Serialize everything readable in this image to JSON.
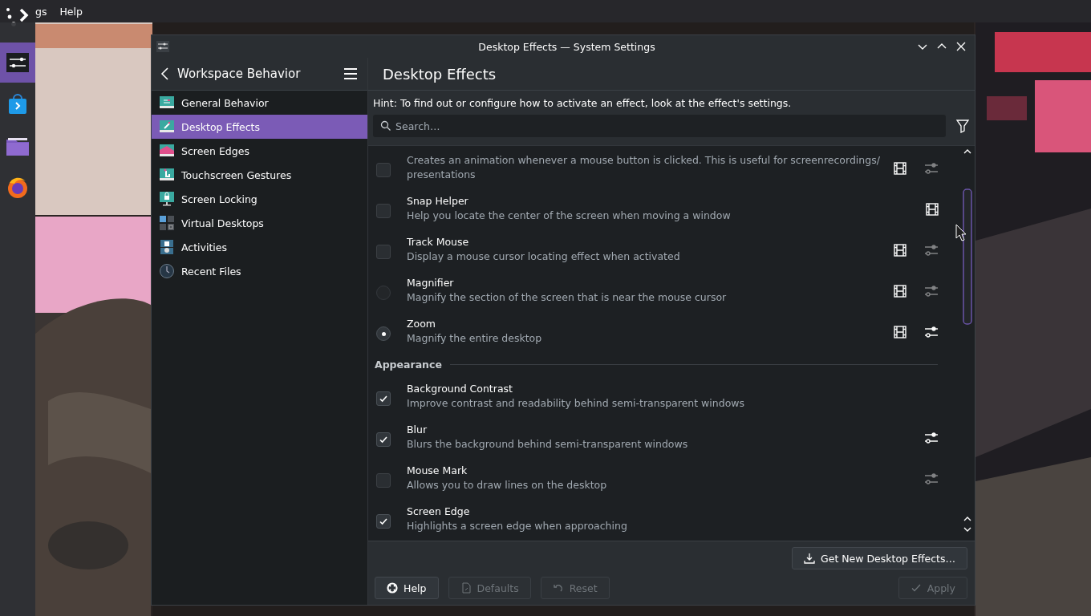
{
  "menu_bar": {
    "items": [
      "gs",
      "Help"
    ]
  },
  "dock": {
    "items": [
      {
        "selected": true
      },
      {
        "selected": false
      },
      {
        "selected": false
      },
      {
        "selected": false
      }
    ]
  },
  "window": {
    "title": "Desktop Effects — System Settings"
  },
  "sidebar": {
    "title": "Workspace Behavior",
    "items": [
      {
        "label": "General Behavior",
        "selected": false
      },
      {
        "label": "Desktop Effects",
        "selected": true
      },
      {
        "label": "Screen Edges",
        "selected": false
      },
      {
        "label": "Touchscreen Gestures",
        "selected": false
      },
      {
        "label": "Screen Locking",
        "selected": false
      },
      {
        "label": "Virtual Desktops",
        "selected": false
      },
      {
        "label": "Activities",
        "selected": false
      },
      {
        "label": "Recent Files",
        "selected": false
      }
    ]
  },
  "page": {
    "title": "Desktop Effects",
    "hint": "Hint: To find out or configure how to activate an effect, look at the effect's settings.",
    "search": {
      "placeholder": "Search…"
    }
  },
  "effects": [
    {
      "kind": "checkbox",
      "checked": false,
      "description": "Creates an animation whenever a mouse button is clicked. This is useful for screenrecordings/ presentations",
      "video": true,
      "configure": true
    },
    {
      "kind": "checkbox",
      "checked": false,
      "name": "Snap Helper",
      "description": "Help you locate the center of the screen when moving a window",
      "video": true,
      "configure": false
    },
    {
      "kind": "checkbox",
      "checked": false,
      "name": "Track Mouse",
      "description": "Display a mouse cursor locating effect when activated",
      "video": true,
      "configure": true
    },
    {
      "kind": "radio",
      "checked": false,
      "name": "Magnifier",
      "description": "Magnify the section of the screen that is near the mouse cursor",
      "video": true,
      "configure": true
    },
    {
      "kind": "radio",
      "checked": true,
      "name": "Zoom",
      "description": "Magnify the entire desktop",
      "video": true,
      "configure": true
    },
    {
      "kind": "category",
      "label": "Appearance"
    },
    {
      "kind": "checkbox",
      "checked": true,
      "name": "Background Contrast",
      "description": "Improve contrast and readability behind semi-transparent windows",
      "video": false,
      "configure": false
    },
    {
      "kind": "checkbox",
      "checked": true,
      "name": "Blur",
      "description": "Blurs the background behind semi-transparent windows",
      "video": false,
      "configure": true
    },
    {
      "kind": "checkbox",
      "checked": false,
      "name": "Mouse Mark",
      "description": "Allows you to draw lines on the desktop",
      "video": false,
      "configure": true
    },
    {
      "kind": "checkbox",
      "checked": true,
      "name": "Screen Edge",
      "description": "Highlights a screen edge when approaching",
      "video": false,
      "configure": false
    }
  ],
  "footer": {
    "get_new": "Get New Desktop Effects…",
    "buttons": [
      {
        "kind": "help",
        "label": "Help",
        "disabled": false
      },
      {
        "kind": "defaults",
        "label": "Defaults",
        "disabled": true
      },
      {
        "kind": "reset",
        "label": "Reset",
        "disabled": true
      },
      {
        "kind": "apply",
        "label": "Apply",
        "disabled": true
      }
    ]
  }
}
